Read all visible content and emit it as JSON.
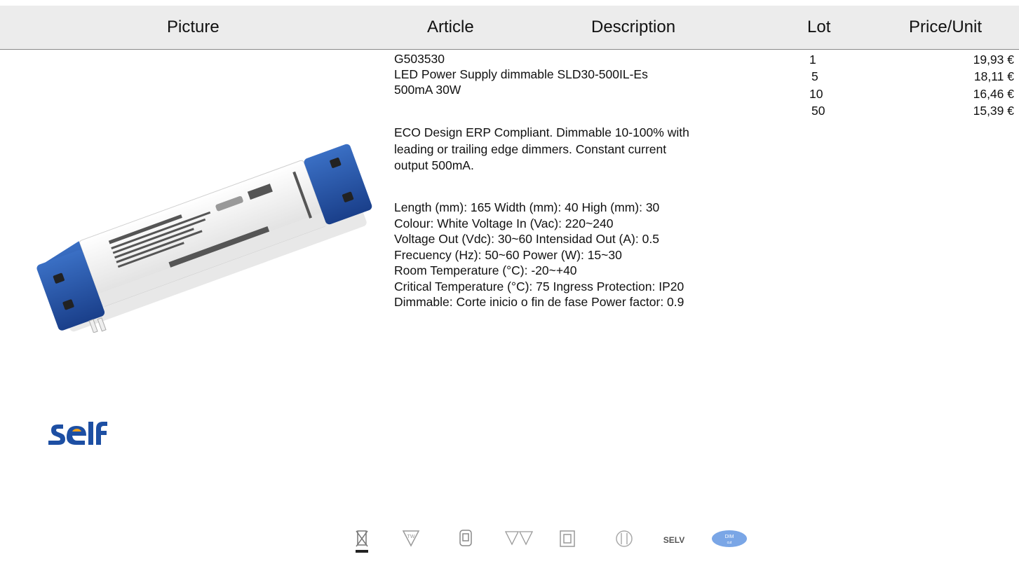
{
  "header": {
    "picture": "Picture",
    "article": "Article",
    "description": "Description",
    "lot": "Lot",
    "price_unit": "Price/Unit"
  },
  "product": {
    "code": "G503530",
    "name": "LED Power Supply dimmable SLD30-500IL-Es",
    "subtitle": "500mA 30W",
    "description": "ECO Design ERP Compliant. Dimmable 10-100% with\nleading or trailing edge dimmers. Constant current\noutput 500mA.",
    "specs": "Length (mm): 165 Width (mm): 40 High (mm): 30\nColour: White Voltage In (Vac): 220~240\nVoltage Out (Vdc): 30~60 Intensidad Out (A): 0.5\nFrecuency (Hz): 50~60 Power (W): 15~30\nRoom Temperature (°C): -20~+40\nCritical Temperature (°C): 75 Ingress Protection: IP20\nDimmable: Corte inicio o fin de fase Power factor: 0.9"
  },
  "prices": [
    {
      "lot": "1",
      "price": "19,93 €"
    },
    {
      "lot": "5",
      "price": "18,11 €"
    },
    {
      "lot": "10",
      "price": "16,46 €"
    },
    {
      "lot": "50",
      "price": "15,39 €"
    }
  ],
  "brand": {
    "logo_text": "self",
    "color": "#1d4fa3",
    "accent": "#f2a21c"
  },
  "device_label": "SLD30-500IL-Es",
  "cert_icons": [
    {
      "name": "weee-bin-icon"
    },
    {
      "name": "tw-triangle-icon"
    },
    {
      "name": "fuse-icon"
    },
    {
      "name": "double-tw-icon"
    },
    {
      "name": "class-ii-icon"
    },
    {
      "name": "safety-transformer-icon"
    },
    {
      "name": "selv-icon",
      "text": "SELV"
    },
    {
      "name": "dimmable-badge-icon",
      "text": "DIM"
    }
  ]
}
